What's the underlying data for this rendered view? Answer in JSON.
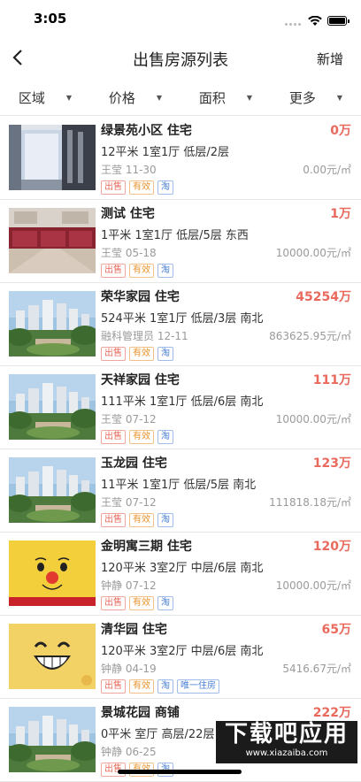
{
  "status": {
    "time": "3:05"
  },
  "nav": {
    "back_icon": "chevron-left-icon",
    "title": "出售房源列表",
    "add_label": "新增"
  },
  "filters": [
    "区域",
    "价格",
    "面积",
    "更多"
  ],
  "listings": [
    {
      "name": "绿景苑小区 住宅",
      "price": "0万",
      "spec": "12平米 1室1厅 低层/2层",
      "agent": "王莹 11-30",
      "unit_price": "0.00元/㎡",
      "tags": [
        "出售",
        "有效",
        "淘"
      ],
      "image": "room"
    },
    {
      "name": "测试 住宅",
      "price": "1万",
      "spec": "1平米 1室1厅 低层/5层 东西",
      "agent": "王莹 05-18",
      "unit_price": "10000.00元/㎡",
      "tags": [
        "出售",
        "有效",
        "淘"
      ],
      "image": "kitchen"
    },
    {
      "name": "荣华家园 住宅",
      "price": "45254万",
      "spec": "524平米 1室1厅 低层/3层 南北",
      "agent": "融科管理员 12-11",
      "unit_price": "863625.95元/㎡",
      "tags": [
        "出售",
        "有效",
        "淘"
      ],
      "image": "buildings"
    },
    {
      "name": "天祥家园 住宅",
      "price": "111万",
      "spec": "111平米 1室1厅 低层/6层 南北",
      "agent": "王莹 07-12",
      "unit_price": "10000.00元/㎡",
      "tags": [
        "出售",
        "有效",
        "淘"
      ],
      "image": "buildings"
    },
    {
      "name": "玉龙园 住宅",
      "price": "123万",
      "spec": "11平米 1室1厅 低层/5层 南北",
      "agent": "王莹 07-12",
      "unit_price": "111818.18元/㎡",
      "tags": [
        "出售",
        "有效",
        "淘"
      ],
      "image": "buildings"
    },
    {
      "name": "金明寓三期 住宅",
      "price": "120万",
      "spec": "120平米 3室2厅 中层/6层 南北",
      "agent": "钟静 07-12",
      "unit_price": "10000.00元/㎡",
      "tags": [
        "出售",
        "有效",
        "淘"
      ],
      "image": "face-pooh"
    },
    {
      "name": "清华园 住宅",
      "price": "65万",
      "spec": "120平米 3室2厅 中层/6层 南北",
      "agent": "钟静 04-19",
      "unit_price": "5416.67元/㎡",
      "tags": [
        "出售",
        "有效",
        "淘",
        "唯一住房"
      ],
      "image": "face-smile"
    },
    {
      "name": "景城花园 商铺",
      "price": "222万",
      "spec": "0平米 室厅 高层/22层",
      "agent": "钟静 06-25",
      "unit_price": "",
      "tags": [
        "出售",
        "有效",
        "淘"
      ],
      "image": "buildings"
    }
  ],
  "watermark": {
    "big": "下载吧应用",
    "small": "www.xiazaiba.com"
  },
  "colors": {
    "price": "#e96a5d",
    "tag_sale": "#e96a5d",
    "tag_valid": "#e8932c",
    "tag_tao": "#4a7fd8"
  }
}
